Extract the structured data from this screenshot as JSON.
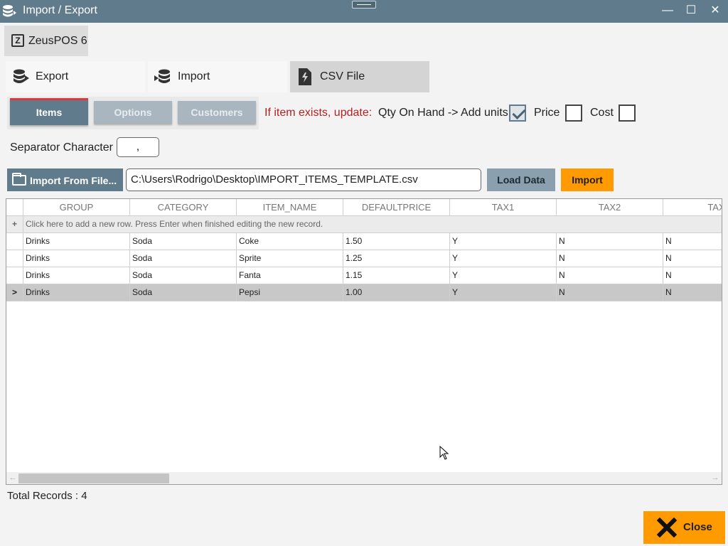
{
  "window": {
    "title": "Import / Export",
    "minimize_glyph": "—",
    "maximize_glyph": "☐",
    "close_glyph": "✕"
  },
  "brand": {
    "label": "ZeusPOS 6",
    "icon_letter": "Z"
  },
  "tabs": [
    {
      "label": "Export",
      "icon": "database-export-icon"
    },
    {
      "label": "Import",
      "icon": "database-import-icon"
    },
    {
      "label": "CSV File",
      "icon": "csv-file-icon"
    }
  ],
  "subtabs": {
    "items": "Items",
    "options": "Options",
    "customers": "Customers"
  },
  "update": {
    "prompt": "If item exists, update:",
    "qty_label": "Qty On Hand -> Add units",
    "qty_checked": true,
    "price_label": "Price",
    "price_checked": false,
    "cost_label": "Cost",
    "cost_checked": false
  },
  "separator": {
    "label": "Separator Character",
    "value": ","
  },
  "file": {
    "button_label": "Import From File...",
    "path": "C:\\Users\\Rodrigo\\Desktop\\IMPORT_ITEMS_TEMPLATE.csv",
    "load_label": "Load Data",
    "import_label": "Import"
  },
  "grid": {
    "columns": [
      "GROUP",
      "CATEGORY",
      "ITEM_NAME",
      "DEFAULTPRICE",
      "TAX1",
      "TAX2",
      "TAX"
    ],
    "new_row_symbol": "+",
    "new_row_text": "Click here to add a new row. Press Enter when finished editing the new record.",
    "selected_indicator": ">",
    "rows": [
      [
        "Drinks",
        "Soda",
        "Coke",
        "1.50",
        "Y",
        "N",
        "N"
      ],
      [
        "Drinks",
        "Soda",
        "Sprite",
        "1.25",
        "Y",
        "N",
        "N"
      ],
      [
        "Drinks",
        "Soda",
        "Fanta",
        "1.15",
        "Y",
        "N",
        "N"
      ],
      [
        "Drinks",
        "Soda",
        "Pepsi",
        "1.00",
        "Y",
        "N",
        "N"
      ]
    ]
  },
  "footer": {
    "total_records": "Total Records : 4",
    "close_label": "Close"
  },
  "colors": {
    "titlebar": "#5f7b8c",
    "accent_orange": "#ff9a00",
    "warning_text": "#b32222"
  }
}
